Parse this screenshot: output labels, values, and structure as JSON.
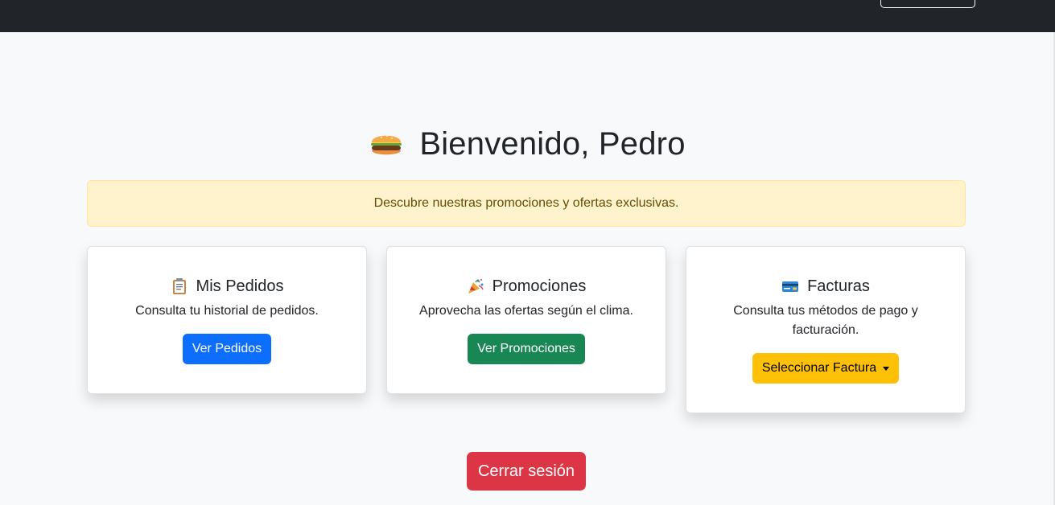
{
  "welcome": {
    "title": "Bienvenido, Pedro",
    "icon": "hamburger-icon"
  },
  "alert": {
    "text": "Descubre nuestras promociones y ofertas exclusivas."
  },
  "cards": [
    {
      "icon": "clipboard-icon",
      "title": "Mis Pedidos",
      "text": "Consulta tu historial de pedidos.",
      "button": "Ver Pedidos",
      "button_color": "#0d6efd"
    },
    {
      "icon": "party-popper-icon",
      "title": "Promociones",
      "text": "Aprovecha las ofertas según el clima.",
      "button": "Ver Promociones",
      "button_color": "#198754"
    },
    {
      "icon": "credit-card-icon",
      "title": "Facturas",
      "text": "Consulta tus métodos de pago y facturación.",
      "button": "Seleccionar Factura",
      "button_color": "#ffc107"
    }
  ],
  "logout": {
    "label": "Cerrar sesión",
    "color": "#dc3545"
  },
  "colors": {
    "navbar": "#212529",
    "background": "#f8f9fa",
    "alert_bg": "#fff3cd"
  }
}
